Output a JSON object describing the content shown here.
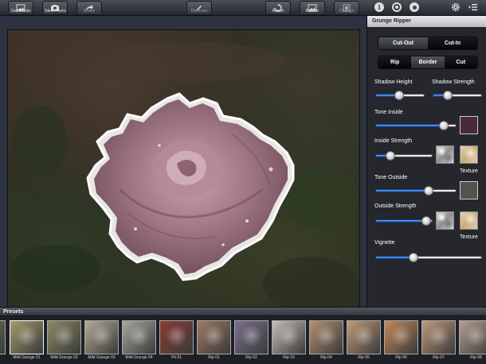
{
  "toolbar": {
    "get_photo": "Get Photo",
    "take_photo": "Take Photo",
    "share": "Share",
    "remove": "Remove",
    "reset": "Reset",
    "before": "Before",
    "change": "Change"
  },
  "panel": {
    "title": "Grunge Ripper",
    "mode_segment": [
      {
        "label": "Cut-Out",
        "active": true
      },
      {
        "label": "Cut-In",
        "active": false
      }
    ],
    "edge_segment": [
      {
        "label": "Rip",
        "active": false
      },
      {
        "label": "Border",
        "active": true
      },
      {
        "label": "Cut",
        "active": false
      }
    ],
    "shadow_height": {
      "label": "Shadow Height",
      "value": 0.48
    },
    "shadow_strength": {
      "label": "Shadow Strength",
      "value": 0.3
    },
    "tone_inside": {
      "label": "Tone Inside",
      "value": 0.84,
      "color": "#4a2a3a"
    },
    "inside_strength": {
      "label": "Inside Strength",
      "value": 0.27
    },
    "texture_label_1": "Texture",
    "tone_outside": {
      "label": "Tone Outside",
      "value": 0.66,
      "color": "#54524f"
    },
    "outside_strength": {
      "label": "Outside Strength",
      "value": 0.89
    },
    "texture_label_2": "Texture",
    "vignette": {
      "label": "Vignette",
      "value": 0.36
    }
  },
  "presets": {
    "title": "Presets",
    "items": [
      {
        "label": "",
        "tone": "#6e7a4a"
      },
      {
        "label": "Mild Grunge 01",
        "tone": "#a59b6e"
      },
      {
        "label": "Mild Grunge 02",
        "tone": "#8c8a64"
      },
      {
        "label": "Mild Grunge 03",
        "tone": "#b3ab96"
      },
      {
        "label": "Mild Grunge 04",
        "tone": "#a8a8a0"
      },
      {
        "label": "Pit 01",
        "tone": "#8c3a32"
      },
      {
        "label": "Rip 01",
        "tone": "#a07a62"
      },
      {
        "label": "Rip 02",
        "tone": "#7a7090"
      },
      {
        "label": "Rip 03",
        "tone": "#c7bfb8"
      },
      {
        "label": "Rip 04",
        "tone": "#b69070"
      },
      {
        "label": "Rip 05",
        "tone": "#c29a78"
      },
      {
        "label": "Rip 06",
        "tone": "#c4885a"
      },
      {
        "label": "Rip 07",
        "tone": "#c29a78"
      },
      {
        "label": "Rip 08",
        "tone": "#b8a090"
      }
    ]
  }
}
